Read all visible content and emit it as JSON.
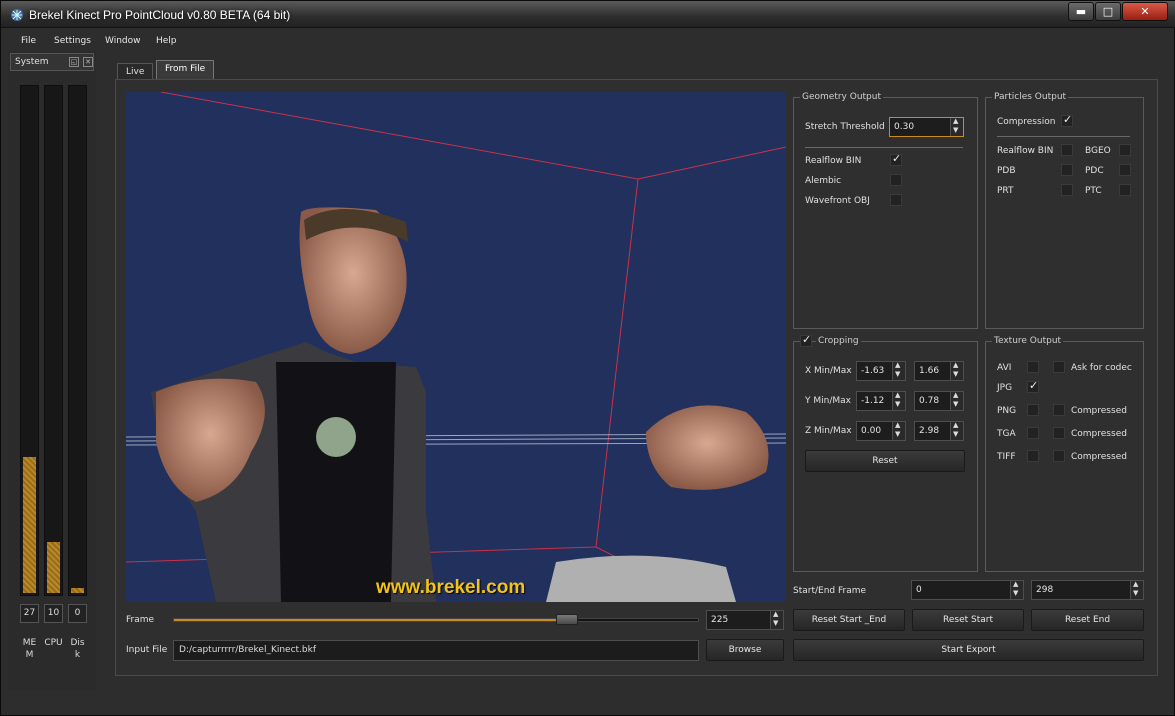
{
  "window": {
    "title": "Brekel Kinect Pro PointCloud v0.80 BETA (64 bit)",
    "controls": {
      "minimize": "▬",
      "maximize": "□",
      "close": "✕"
    }
  },
  "menu": [
    "File",
    "Settings",
    "Window",
    "Help"
  ],
  "system": {
    "title": "System",
    "meters": [
      {
        "label": "MEM",
        "value": "27",
        "level": 0.27
      },
      {
        "label": "CPU",
        "value": "10",
        "level": 0.1
      },
      {
        "label": "Disk",
        "value": "0",
        "level": 0.01
      }
    ]
  },
  "tabs": [
    "Live",
    "From File"
  ],
  "viewport": {
    "watermark": "www.brekel.com"
  },
  "playback": {
    "frame_label": "Frame",
    "frame_value": "225",
    "frame_fraction": 0.75,
    "input_label": "Input File",
    "input_value": "D:/capturrrrr/Brekel_Kinect.bkf",
    "browse_label": "Browse"
  },
  "geometry_output": {
    "title": "Geometry Output",
    "stretch_label": "Stretch Threshold",
    "stretch_value": "0.30",
    "formats": [
      {
        "label": "Realflow BIN",
        "checked": true
      },
      {
        "label": "Alembic",
        "checked": false
      },
      {
        "label": "Wavefront OBJ",
        "checked": false
      }
    ]
  },
  "particles_output": {
    "title": "Particles Output",
    "compression_label": "Compression",
    "compression_checked": true,
    "formats": [
      "Realflow BIN",
      "BGEO",
      "PDB",
      "PDC",
      "PRT",
      "PTC"
    ]
  },
  "cropping": {
    "title": "Cropping",
    "enabled": true,
    "rows": [
      {
        "label": "X Min/Max",
        "min": "-1.63",
        "max": "1.66"
      },
      {
        "label": "Y Min/Max",
        "min": "-1.12",
        "max": "0.78"
      },
      {
        "label": "Z Min/Max",
        "min": "0.00",
        "max": "2.98"
      }
    ],
    "reset_label": "Reset"
  },
  "texture_output": {
    "title": "Texture Output",
    "formats": [
      {
        "label": "AVI",
        "checked": false,
        "extra": "Ask for codec"
      },
      {
        "label": "JPG",
        "checked": true,
        "extra": ""
      },
      {
        "label": "PNG",
        "checked": false,
        "extra": "Compressed"
      },
      {
        "label": "TGA",
        "checked": false,
        "extra": "Compressed"
      },
      {
        "label": "TIFF",
        "checked": false,
        "extra": "Compressed"
      }
    ]
  },
  "export": {
    "range_label": "Start/End Frame",
    "start_value": "0",
    "end_value": "298",
    "reset_start_end": "Reset Start _End",
    "reset_start": "Reset Start",
    "reset_end": "Reset End",
    "start_export": "Start Export"
  },
  "colors": {
    "accent": "#c98a1e",
    "viewport_bg": "#21305c",
    "watermark": "#f2c318"
  }
}
